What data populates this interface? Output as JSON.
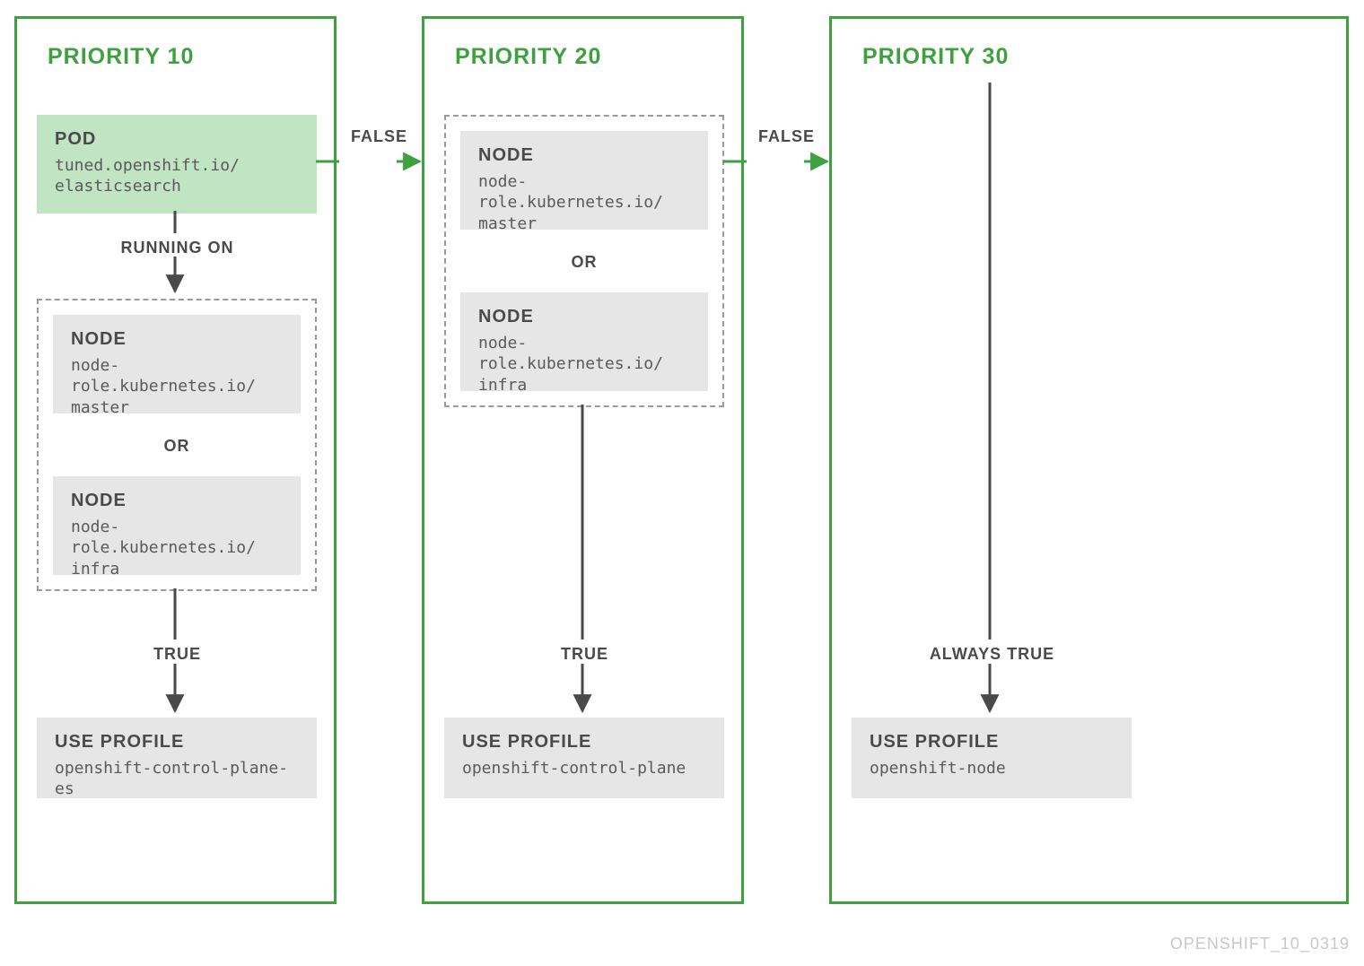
{
  "colors": {
    "green": "#3fa040",
    "green_fill": "#c1e4c2",
    "gray_fill": "#e6e6e6",
    "text_dark": "#4a4a4a",
    "text_mid": "#5a5a5a",
    "dash": "#9a9a9a"
  },
  "footer": "OPENSHIFT_10_0319",
  "panels": {
    "p10": {
      "title": "PRIORITY 10",
      "pod": {
        "title": "POD",
        "sub": "tuned.openshift.io/\nelasticsearch"
      },
      "running_on": "RUNNING ON",
      "node1": {
        "title": "NODE",
        "sub": "node-role.kubernetes.io/\nmaster"
      },
      "or": "OR",
      "node2": {
        "title": "NODE",
        "sub": "node-role.kubernetes.io/\ninfra"
      },
      "true": "TRUE",
      "profile": {
        "title": "USE PROFILE",
        "sub": "openshift-control-plane-es"
      }
    },
    "p20": {
      "title": "PRIORITY 20",
      "node1": {
        "title": "NODE",
        "sub": "node-role.kubernetes.io/\nmaster"
      },
      "or": "OR",
      "node2": {
        "title": "NODE",
        "sub": "node-role.kubernetes.io/\ninfra"
      },
      "true": "TRUE",
      "profile": {
        "title": "USE PROFILE",
        "sub": "openshift-control-plane"
      }
    },
    "p30": {
      "title": "PRIORITY 30",
      "always_true": "ALWAYS TRUE",
      "profile": {
        "title": "USE PROFILE",
        "sub": "openshift-node"
      }
    }
  },
  "edges": {
    "false1": "FALSE",
    "false2": "FALSE"
  }
}
